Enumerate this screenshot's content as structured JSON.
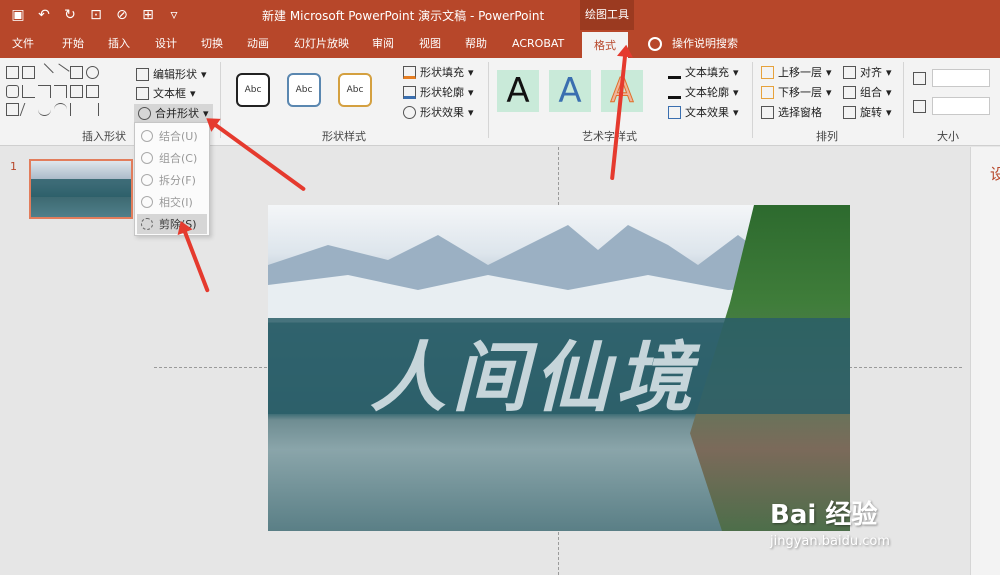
{
  "window": {
    "title": "新建 Microsoft PowerPoint 演示文稿  -  PowerPoint",
    "context_group": "绘图工具"
  },
  "qat_icons": [
    "save-icon",
    "undo-icon",
    "redo-icon",
    "present-icon",
    "shape-icon",
    "format-icon",
    "customize-icon"
  ],
  "tabs": [
    "文件",
    "开始",
    "插入",
    "设计",
    "切换",
    "动画",
    "幻灯片放映",
    "审阅",
    "视图",
    "帮助",
    "ACROBAT",
    "格式"
  ],
  "active_tab": "格式",
  "search_label": "操作说明搜索",
  "ribbon": {
    "insert_shapes": {
      "label": "插入形状",
      "edit_shape": "编辑形状",
      "text_box": "文本框",
      "merge_shapes": "合并形状"
    },
    "shape_styles": {
      "label": "形状样式",
      "preview": "Abc",
      "fill": "形状填充",
      "outline": "形状轮廓",
      "effects": "形状效果"
    },
    "wordart": {
      "label": "艺术字样式",
      "preview": "A",
      "text_fill": "文本填充",
      "text_outline": "文本轮廓",
      "text_effects": "文本效果"
    },
    "arrange": {
      "label": "排列",
      "bring_forward": "上移一层",
      "send_backward": "下移一层",
      "selection_pane": "选择窗格",
      "align": "对齐",
      "group": "组合",
      "rotate": "旋转"
    },
    "size": {
      "label": "大小"
    }
  },
  "merge_menu": {
    "items": [
      "结合(U)",
      "组合(C)",
      "拆分(F)",
      "相交(I)",
      "剪除(S)"
    ],
    "highlighted": "剪除(S)"
  },
  "slides": {
    "number": "1"
  },
  "slide": {
    "title_text": "人间仙境"
  },
  "right_panel": {
    "title": "设"
  },
  "watermark": {
    "main": "Bai 经验",
    "sub": "jingyan.baidu.com"
  },
  "colors": {
    "accent": "#b7472a",
    "arrow": "#e53a2e"
  }
}
